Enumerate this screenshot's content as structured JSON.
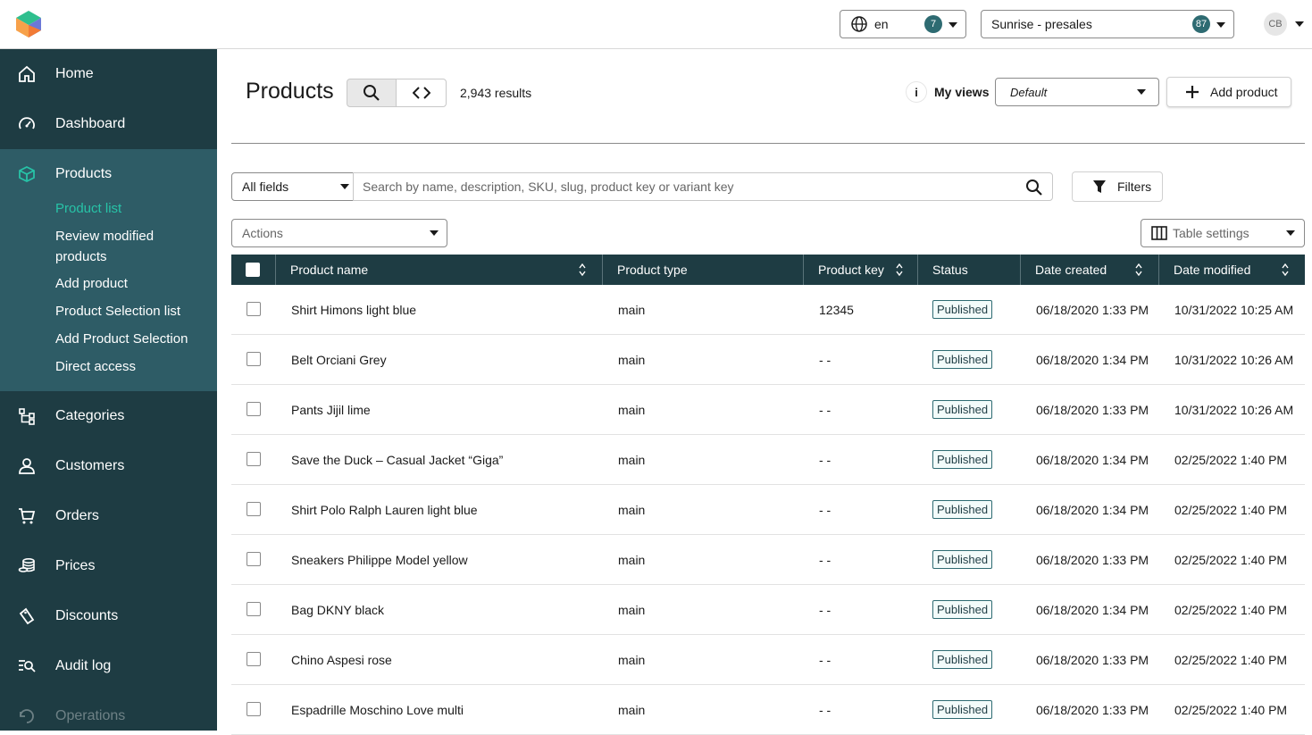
{
  "topbar": {
    "language": "en",
    "language_count": "7",
    "project": "Sunrise - presales",
    "project_count": "87",
    "user_initials": "CB"
  },
  "sidebar": {
    "items": [
      {
        "label": "Home",
        "icon": "home-icon"
      },
      {
        "label": "Dashboard",
        "icon": "gauge-icon"
      },
      {
        "label": "Products",
        "icon": "cube-icon"
      },
      {
        "label": "Categories",
        "icon": "hierarchy-icon"
      },
      {
        "label": "Customers",
        "icon": "user-icon"
      },
      {
        "label": "Orders",
        "icon": "cart-icon"
      },
      {
        "label": "Prices",
        "icon": "coins-icon"
      },
      {
        "label": "Discounts",
        "icon": "tag-icon"
      },
      {
        "label": "Audit log",
        "icon": "audit-icon"
      },
      {
        "label": "Operations",
        "icon": "operations-icon"
      }
    ],
    "product_sub": [
      "Product list",
      "Review modified products",
      "Add product",
      "Product Selection list",
      "Add Product Selection",
      "Direct access"
    ]
  },
  "main": {
    "title": "Products",
    "results": "2,943 results",
    "info": "i",
    "my_views_label": "My views",
    "view_selected": "Default",
    "add_product": "Add product",
    "search_field": "All fields",
    "search_placeholder": "Search by name, description, SKU, slug, product key or variant key",
    "filters": "Filters",
    "actions": "Actions",
    "table_settings": "Table settings"
  },
  "table": {
    "columns": [
      "Product name",
      "Product type",
      "Product key",
      "Status",
      "Date created",
      "Date modified"
    ],
    "rows": [
      {
        "name": "Shirt Himons light blue",
        "type": "main",
        "key": "12345",
        "status": "Published",
        "created": "06/18/2020 1:33 PM",
        "modified": "10/31/2022 10:25 AM"
      },
      {
        "name": "Belt Orciani Grey",
        "type": "main",
        "key": "- -",
        "status": "Published",
        "created": "06/18/2020 1:34 PM",
        "modified": "10/31/2022 10:26 AM"
      },
      {
        "name": "Pants Jijil lime",
        "type": "main",
        "key": "- -",
        "status": "Published",
        "created": "06/18/2020 1:33 PM",
        "modified": "10/31/2022 10:26 AM"
      },
      {
        "name": "Save the Duck – Casual Jacket “Giga”",
        "type": "main",
        "key": "- -",
        "status": "Published",
        "created": "06/18/2020 1:34 PM",
        "modified": "02/25/2022 1:40 PM"
      },
      {
        "name": "Shirt Polo Ralph Lauren light blue",
        "type": "main",
        "key": "- -",
        "status": "Published",
        "created": "06/18/2020 1:34 PM",
        "modified": "02/25/2022 1:40 PM"
      },
      {
        "name": "Sneakers Philippe Model yellow",
        "type": "main",
        "key": "- -",
        "status": "Published",
        "created": "06/18/2020 1:33 PM",
        "modified": "02/25/2022 1:40 PM"
      },
      {
        "name": "Bag DKNY black",
        "type": "main",
        "key": "- -",
        "status": "Published",
        "created": "06/18/2020 1:34 PM",
        "modified": "02/25/2022 1:40 PM"
      },
      {
        "name": "Chino Aspesi rose",
        "type": "main",
        "key": "- -",
        "status": "Published",
        "created": "06/18/2020 1:33 PM",
        "modified": "02/25/2022 1:40 PM"
      },
      {
        "name": "Espadrille Moschino Love multi",
        "type": "main",
        "key": "- -",
        "status": "Published",
        "created": "06/18/2020 1:33 PM",
        "modified": "02/25/2022 1:40 PM"
      }
    ]
  },
  "colors": {
    "sidebar_bg": "#1e3c43",
    "sidebar_active_bg": "#2e5c66",
    "accent": "#27c3a7",
    "badge_border": "#2e6b72"
  }
}
